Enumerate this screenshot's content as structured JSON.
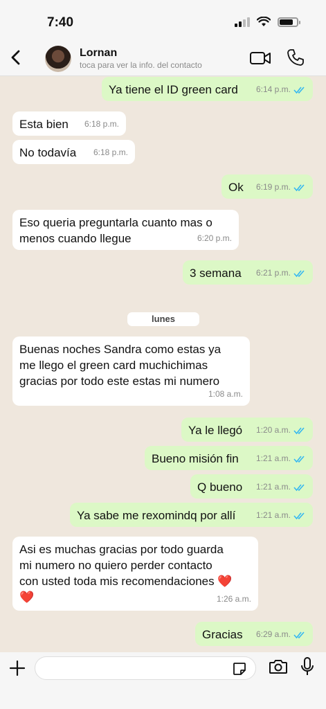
{
  "status": {
    "time": "7:40"
  },
  "header": {
    "contact_name": "Lornan",
    "subtitle": "toca para ver la info. del contacto"
  },
  "day_separator": "lunes",
  "messages": [
    {
      "dir": "out",
      "text": "Ya tiene el ID green card",
      "time": "6:14 p.m."
    },
    {
      "dir": "in",
      "text": "Esta bien",
      "time": "6:18 p.m."
    },
    {
      "dir": "in",
      "text": "No todavía",
      "time": "6:18 p.m."
    },
    {
      "dir": "out",
      "text": "Ok",
      "time": "6:19 p.m."
    },
    {
      "dir": "in",
      "line1": "Eso queria preguntarla cuanto  mas o",
      "line2": "menos cuando llegue",
      "time": "6:20 p.m."
    },
    {
      "dir": "out",
      "text": "3 semana",
      "time": "6:21 p.m."
    },
    {
      "dir": "in",
      "line1": "Buenas noches  Sandra como estas  ya",
      "line2": "me llego   el green card muchichimas",
      "line3": "gracias por todo  este estas mi numero",
      "time": "1:08 a.m."
    },
    {
      "dir": "out",
      "text": "Ya le llegó",
      "time": "1:20 a.m."
    },
    {
      "dir": "out",
      "text": "Bueno misión fin",
      "time": "1:21 a.m."
    },
    {
      "dir": "out",
      "text": "Q bueno",
      "time": "1:21 a.m."
    },
    {
      "dir": "out",
      "text": "Ya sabe me rexomindq por allí",
      "time": "1:21 a.m."
    },
    {
      "dir": "in",
      "line1": "Asi es muchas gracias por todo guarda",
      "line2": "mi numero  no quiero perder contacto",
      "line3": "con usted toda mis recomendaciones ❤️",
      "line4": "❤️",
      "time": "1:26 a.m."
    },
    {
      "dir": "out",
      "text": "Gracias",
      "time": "6:29 a.m."
    }
  ],
  "colors": {
    "incoming": "#ffffff",
    "outgoing": "#dcf8c6",
    "read_tick": "#34b7f1",
    "background": "#efe7dd"
  },
  "icons": [
    "back-icon",
    "video-call-icon",
    "phone-icon",
    "plus-icon",
    "sticker-icon",
    "camera-icon",
    "microphone-icon"
  ]
}
